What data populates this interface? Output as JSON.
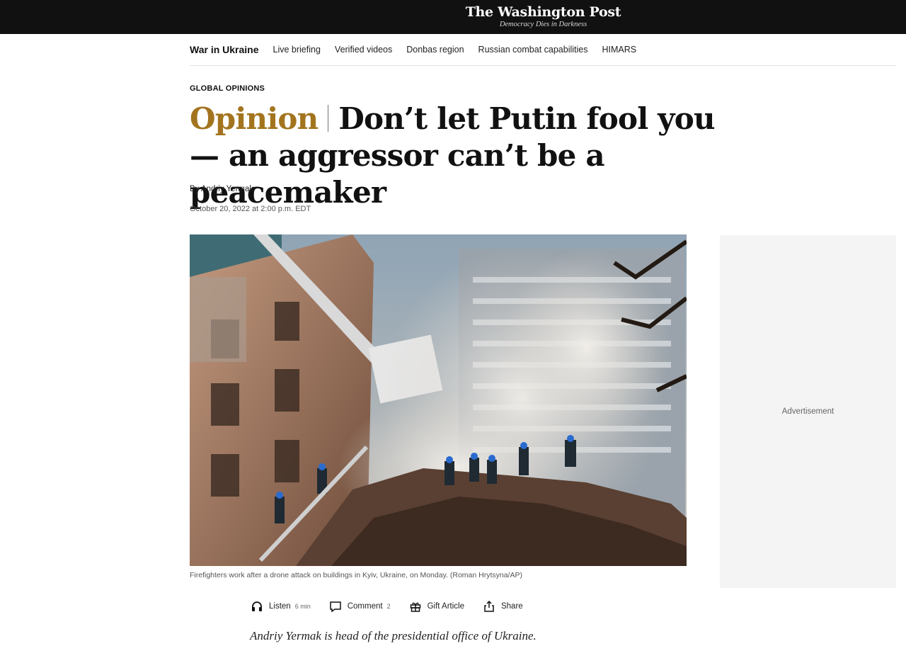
{
  "masthead": {
    "logo_title": "The Washington Post",
    "logo_tagline": "Democracy Dies in Darkness",
    "background": "#111111"
  },
  "section_nav": {
    "title": "War in Ukraine",
    "items": [
      "Live briefing",
      "Verified videos",
      "Donbas region",
      "Russian combat capabilities",
      "HIMARS"
    ]
  },
  "article": {
    "kicker": "GLOBAL OPINIONS",
    "label": "Opinion",
    "headline": "Don’t let Putin fool you — an aggressor can’t be a peacemaker",
    "byline_prefix": "By ",
    "author": "Andriy Yermak",
    "date": "October 20, 2022 at 2:00 p.m. EDT",
    "caption": "Firefighters work after a drone attack on buildings in Kyiv, Ukraine, on Monday. (Roman Hrytsyna/AP)",
    "standfirst": "Andriy Yermak is head of the presidential office of Ukraine."
  },
  "advertisement": {
    "label": "Advertisement"
  },
  "tools": {
    "listen": {
      "label": "Listen",
      "meta": "6 min",
      "icon": "headphones-icon"
    },
    "comment": {
      "label": "Comment",
      "meta": "2",
      "icon": "comment-icon"
    },
    "gift": {
      "label": "Gift Article",
      "icon": "gift-icon"
    },
    "share": {
      "label": "Share",
      "icon": "share-icon"
    }
  },
  "colors": {
    "opinion_accent": "#a3741e"
  }
}
